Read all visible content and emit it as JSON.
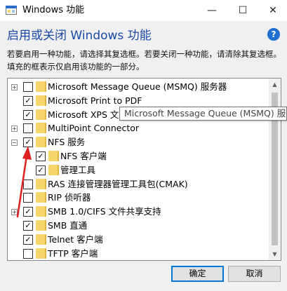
{
  "window": {
    "title": "Windows 功能",
    "minimize_glyph": "—",
    "maximize_glyph": "☐",
    "close_glyph": "✕"
  },
  "header": {
    "heading": "启用或关闭 Windows 功能",
    "description": "若要启用一种功能，请选择其复选框。若要关闭一种功能，请清除其复选框。填充的框表示仅启用该功能的一部分。",
    "help_glyph": "?"
  },
  "features": [
    {
      "label": "Microsoft Message Queue (MSMQ) 服务器",
      "level": 0,
      "expander": "+",
      "checked": false
    },
    {
      "label": "Microsoft Print to PDF",
      "level": 0,
      "expander": "",
      "checked": true
    },
    {
      "label": "Microsoft XPS 文档",
      "level": 0,
      "expander": "",
      "checked": true
    },
    {
      "label": "MultiPoint Connector",
      "level": 0,
      "expander": "+",
      "checked": false
    },
    {
      "label": "NFS 服务",
      "level": 0,
      "expander": "−",
      "checked": true
    },
    {
      "label": "NFS 客户端",
      "level": 1,
      "expander": "",
      "checked": true
    },
    {
      "label": "管理工具",
      "level": 1,
      "expander": "",
      "checked": true
    },
    {
      "label": "RAS 连接管理器管理工具包(CMAK)",
      "level": 0,
      "expander": "",
      "checked": false
    },
    {
      "label": "RIP 侦听器",
      "level": 0,
      "expander": "",
      "checked": false
    },
    {
      "label": "SMB 1.0/CIFS 文件共享支持",
      "level": 0,
      "expander": "+",
      "checked": true
    },
    {
      "label": "SMB 直通",
      "level": 0,
      "expander": "",
      "checked": true
    },
    {
      "label": "Telnet 客户端",
      "level": 0,
      "expander": "",
      "checked": true
    },
    {
      "label": "TFTP 客户端",
      "level": 0,
      "expander": "",
      "checked": false
    }
  ],
  "tooltip": {
    "text": "Microsoft Message Queue (MSMQ) 服务器"
  },
  "scrollbar": {
    "up_glyph": "▲",
    "down_glyph": "▼"
  },
  "buttons": {
    "ok_label": "确定",
    "cancel_label": "取消"
  },
  "colors": {
    "heading": "#1a49a6",
    "annotation_arrow": "#e02020",
    "ok_focus": "#0078d7"
  }
}
